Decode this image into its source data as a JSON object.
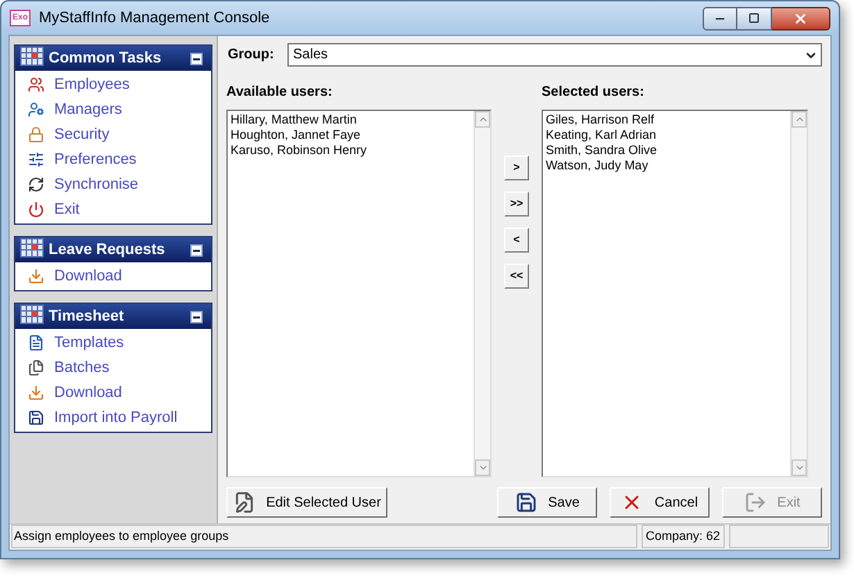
{
  "window": {
    "title": "MyStaffInfo Management Console",
    "app_icon": "Exo"
  },
  "sidebar": {
    "panels": [
      {
        "title": "Common Tasks",
        "items": [
          {
            "label": "Employees",
            "kind": "people"
          },
          {
            "label": "Managers",
            "kind": "manager"
          },
          {
            "label": "Security",
            "kind": "lock"
          },
          {
            "label": "Preferences",
            "kind": "prefs"
          },
          {
            "label": "Synchronise",
            "kind": "sync"
          },
          {
            "label": "Exit",
            "kind": "exit"
          }
        ]
      },
      {
        "title": "Leave Requests",
        "items": [
          {
            "label": "Download",
            "kind": "download"
          }
        ]
      },
      {
        "title": "Timesheet",
        "items": [
          {
            "label": "Templates",
            "kind": "template"
          },
          {
            "label": "Batches",
            "kind": "batch"
          },
          {
            "label": "Download",
            "kind": "download"
          },
          {
            "label": "Import into Payroll",
            "kind": "save"
          }
        ]
      }
    ]
  },
  "group": {
    "label": "Group:",
    "value": "Sales"
  },
  "available": {
    "label": "Available users:",
    "items": [
      "Hillary, Matthew Martin",
      "Houghton, Jannet Faye",
      "Karuso, Robinson Henry"
    ]
  },
  "move_buttons": [
    ">",
    ">>",
    "<",
    "<<"
  ],
  "selected": {
    "label": "Selected users:",
    "items": [
      "Giles, Harrison Relf",
      "Keating, Karl Adrian",
      "Smith, Sandra Olive",
      "Watson, Judy May"
    ]
  },
  "buttons": [
    {
      "label": "Edit Selected User",
      "kind": "edit",
      "disabled": false
    },
    {
      "label": "Save",
      "kind": "save",
      "disabled": false
    },
    {
      "label": "Cancel",
      "kind": "cancel",
      "disabled": false
    },
    {
      "label": "Exit",
      "kind": "exit",
      "disabled": true
    }
  ],
  "status_bar": {
    "message": "Assign employees to employee groups",
    "company": "Company: 62"
  }
}
